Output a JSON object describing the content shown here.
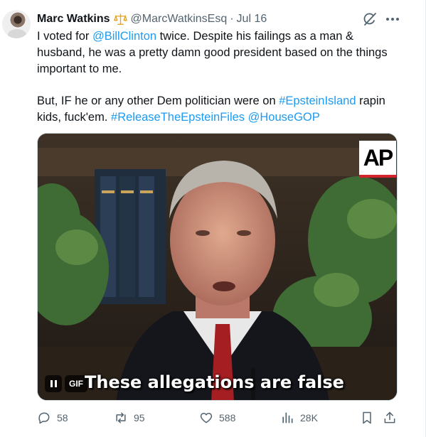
{
  "tweet": {
    "author": {
      "name": "Marc Watkins",
      "handle": "@MarcWatkinsEsq",
      "separator": "·",
      "date": "Jul 16",
      "badge_icon": "scales-of-justice-icon"
    },
    "body": {
      "line1_pre": "I voted for ",
      "line1_mention": "@BillClinton",
      "line1_post": " twice. Despite his failings as a man & husband, he was a pretty damn good president based on the things important to me.",
      "line2_pre": "But, IF he or any other Dem politician were on ",
      "hashtag1": "#EpsteinIsland",
      "line2_mid": " rapin kids, fuck'em. ",
      "hashtag2": "#ReleaseTheEpsteinFiles",
      "space": " ",
      "mention2": "@HouseGOP"
    },
    "media": {
      "caption": "These allegations are false",
      "gif_label": "GIF",
      "watermark": "AP"
    },
    "actions": {
      "replies": "58",
      "reposts": "95",
      "likes": "588",
      "views": "28K"
    },
    "colors": {
      "link": "#1d9bf0",
      "muted": "#536471",
      "text": "#0f1419"
    }
  }
}
